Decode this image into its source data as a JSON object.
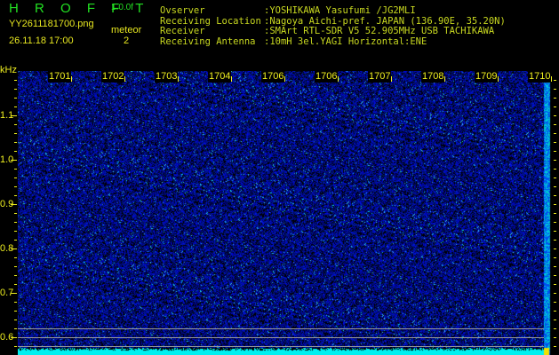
{
  "app": {
    "title_letters": "H R O F F T",
    "version": "1.0.0f"
  },
  "file": {
    "name": "YY2611181700.png",
    "datetime": "26.11.18 17:00"
  },
  "detection": {
    "label": "meteor",
    "count": "2"
  },
  "info": [
    {
      "key": "Ovserver",
      "value": ":YOSHIKAWA Yasufumi /JG2MLI"
    },
    {
      "key": "Receiving Location",
      "value": ":Nagoya Aichi-pref. JAPAN (136.90E, 35.20N)"
    },
    {
      "key": "Receiver",
      "value": ":SMArt RTL-SDR V5 52.905MHz USB TACHIKAWA"
    },
    {
      "key": "Receiving Antenna",
      "value": ":10mH 3el.YAGI Horizontal:ENE"
    }
  ],
  "axis": {
    "unit": "kHz",
    "y_labels": [
      "1.1",
      "1.0",
      "0.9",
      "0.8",
      "0.7",
      "0.6"
    ],
    "time_labels": [
      "1701",
      "1702",
      "1703",
      "1704",
      "1706",
      "1706",
      "1707",
      "1708",
      "1709",
      "1710"
    ]
  },
  "colors": {
    "text_green": "#22e022",
    "text_yellow": "#e8e820",
    "noise_blue": "#1010e0",
    "signal_cyan": "#00f0f0"
  }
}
